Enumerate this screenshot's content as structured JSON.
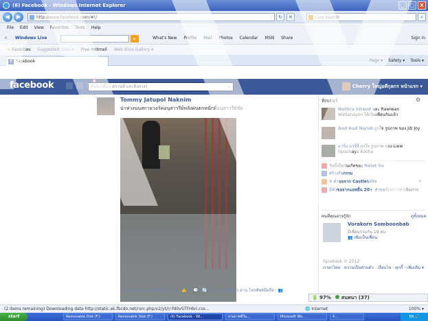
{
  "window": {
    "title": "(6) Facebook - Windows Internet Explorer",
    "minimize": "_",
    "maximize": "□",
    "close": "X"
  },
  "address": {
    "url": "http://www.facebook.com/#!/",
    "search_placeholder": "Live Search",
    "refresh": "↻",
    "stop": "✕",
    "go": "⌕",
    "back": "◀",
    "forward": "▶"
  },
  "menu": [
    "File",
    "Edit",
    "View",
    "Favorites",
    "Tools",
    "Help"
  ],
  "wltoolbar": {
    "close": "×",
    "brand": "Windows Live",
    "go": "▸",
    "links": [
      "What's New",
      "Profile",
      "Mail",
      "Photos",
      "Calendar",
      "MSN",
      "Share"
    ],
    "signin": "Sign in"
  },
  "favbar": {
    "favorites": "Favorites",
    "items": [
      "Suggested Sites ▾",
      "Free Hotmail",
      "Web Slice Gallery ▾"
    ]
  },
  "tab": {
    "title": "Facebook",
    "icon_letter": "f"
  },
  "cmdbar": [
    "Page ▾",
    "Safety ▾",
    "Tools ▾"
  ],
  "fb": {
    "logo": "facebook",
    "notif_count": "6",
    "search_placeholder": "ค้นหาเพื่อน สถานที่ และสิ่งต่างๆ",
    "user": "Cherry ใหญ่อดีกุลกร   หน้าแรก ▾"
  },
  "post": {
    "author": "Tommy Jatupol Naknim",
    "text": "น่าห่วงนนสกายวอร์คอนุสาวรีย์หลังฝนตกหนักที่อนุสาวรีย์ชัย",
    "actions": "ถูกใจ · แสดงความคิดเห็น · แชร์ · 👍16 💬3 🔄3 · 32 นาทีที่แล้ว ผ่าน โทรศัพท์มือถือ · 👥"
  },
  "ticker": {
    "header": "ทิกเกอร์",
    "cog": "⚙",
    "items": [
      {
        "name": "Nattira Intaud",
        "rest": " และ Rawiwan Wattanayon ได้เป็นเพื่อนกันแล้ว"
      },
      {
        "name": "Aud Aud Naruk",
        "rest": " ถูกใจ รูปภาพ ของ Jib Joy"
      },
      {
        "name": "อาร์ม อาร์มี่",
        "rest": " ถูกใจ รูปภาพ ของ Liew Farachaya Kooha"
      }
    ]
  },
  "right_list": [
    {
      "text": "วันนี้เป็นวันเกิดของ ",
      "bold": "Nalat Su",
      "icon_color": "#d84545"
    },
    {
      "text": "",
      "bold": "สร้างกิจกรรม",
      "icon_color": "#5b79b4"
    },
    {
      "text": "",
      "bold": "9 คำขอจาก CastleVille",
      "icon_color": "#e07a2a",
      "close": "×"
    },
    {
      "text": "",
      "bold": "มีคำขอจากแอพอื่น 20+ คำขอ",
      "rest": "ที่รอการดำเนินการ",
      "icon_color": "#c94f4f"
    }
  ],
  "pymk": {
    "header": "คนที่คุณอาจรู้จัก",
    "see_all": "ดูทั้งหมด",
    "name": "Vorakorn Somboonbab",
    "mutual": "มีเพื่อนร่วมกัน 19 คน",
    "add": "👥 เพิ่มเป็นเพื่อน"
  },
  "footer": {
    "copyright": "Facebook © 2012",
    "links": "ภาษาไทย · ความเป็นส่วนตัว · เงื่อนไข · คุกกี้ · เพิ่มเติม ▾"
  },
  "chat": {
    "battery": "🔋 97%",
    "label": "สนทนา (37)"
  },
  "status": {
    "text": "(2 items remaining) Downloading data http://static.ak.fbcdn.net/rsrc.php/v2/yt/r/-fd0vSTFHbri.css...",
    "zone": "Internet",
    "zoom": "100% ▾"
  },
  "taskbar": {
    "start": "start",
    "items": [
      "Removable Disk (F:)",
      "Removable Disk (F:)",
      "(6) Facebook - Wi...",
      "ถ่ายภาพที่ใน...",
      "Microsoft Wo...",
      "4 ..."
    ],
    "clock": "EN 🔊"
  }
}
